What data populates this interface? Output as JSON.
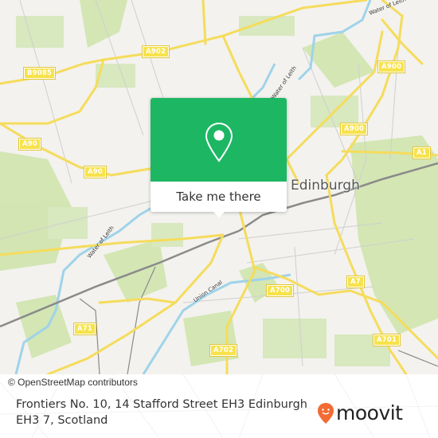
{
  "map": {
    "place_label": "Edinburgh",
    "road_labels": [
      {
        "id": "a902",
        "text": "A902"
      },
      {
        "id": "b9085",
        "text": "B9085"
      },
      {
        "id": "a90-1",
        "text": "A90"
      },
      {
        "id": "a90-2",
        "text": "A90"
      },
      {
        "id": "a900-1",
        "text": "A900"
      },
      {
        "id": "a900-2",
        "text": "A900"
      },
      {
        "id": "a1",
        "text": "A1"
      },
      {
        "id": "a71",
        "text": "A71"
      },
      {
        "id": "a700",
        "text": "A700"
      },
      {
        "id": "a7",
        "text": "A7"
      },
      {
        "id": "a702",
        "text": "A702"
      },
      {
        "id": "a701",
        "text": "A701"
      }
    ],
    "water_labels": {
      "water_of_leith_1": "Water of Leith",
      "water_of_leith_2": "Water of Leith",
      "water_of_leith_3": "Water of Leith",
      "union_canal": "Union Canal"
    },
    "attribution": "© OpenStreetMap contributors",
    "colors": {
      "background": "#f3f2ee",
      "green": "#c8e0a4",
      "road": "#f5dc5c",
      "water": "#9fd3ea",
      "rail": "#888888"
    }
  },
  "popup": {
    "icon": "location-pin-icon",
    "button_label": "Take me there",
    "color": "#1db764"
  },
  "footer": {
    "address": "Frontiers No. 10, 14 Stafford Street EH3 Edinburgh EH3 7, Scotland",
    "logo_text": "moovit",
    "logo_color": "#f26b35"
  }
}
